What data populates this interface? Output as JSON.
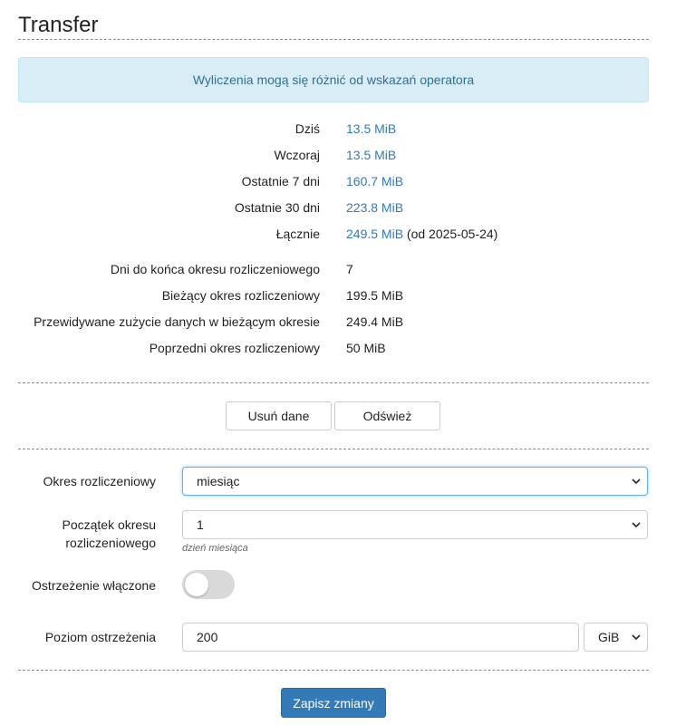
{
  "page": {
    "title": "Transfer"
  },
  "alert": {
    "text": "Wyliczenia mogą się różnić od wskazań operatora"
  },
  "stats": {
    "today": {
      "label": "Dziś",
      "value": "13.5 MiB"
    },
    "yesterday": {
      "label": "Wczoraj",
      "value": "13.5 MiB"
    },
    "last7": {
      "label": "Ostatnie 7 dni",
      "value": "160.7 MiB"
    },
    "last30": {
      "label": "Ostatnie 30 dni",
      "value": "223.8 MiB"
    },
    "total": {
      "label": "Łącznie",
      "value": "249.5 MiB",
      "suffix": " (od 2025-05-24)"
    }
  },
  "period": {
    "days_left": {
      "label": "Dni do końca okresu rozliczeniowego",
      "value": "7"
    },
    "current": {
      "label": "Bieżący okres rozliczeniowy",
      "value": "199.5 MiB"
    },
    "predicted": {
      "label": "Przewidywane zużycie danych w bieżącym okresie",
      "value": "249.4 MiB"
    },
    "previous": {
      "label": "Poprzedni okres rozliczeniowy",
      "value": "50 MiB"
    }
  },
  "actions": {
    "delete_label": "Usuń dane",
    "refresh_label": "Odśwież"
  },
  "form": {
    "billing_period": {
      "label": "Okres rozliczeniowy",
      "value": "miesiąc"
    },
    "period_start": {
      "label_line1": "Początek okresu",
      "label_line2": "rozliczeniowego",
      "value": "1",
      "hint": "dzień miesiąca"
    },
    "warning_enabled": {
      "label": "Ostrzeżenie włączone",
      "on": false
    },
    "warning_level": {
      "label": "Poziom ostrzeżenia",
      "value": "200",
      "unit": "GiB"
    },
    "save_label": "Zapisz zmiany"
  },
  "colors": {
    "link": "#337ab7",
    "alert_bg": "#d9edf7",
    "alert_text": "#31708f",
    "primary": "#337ab7"
  }
}
